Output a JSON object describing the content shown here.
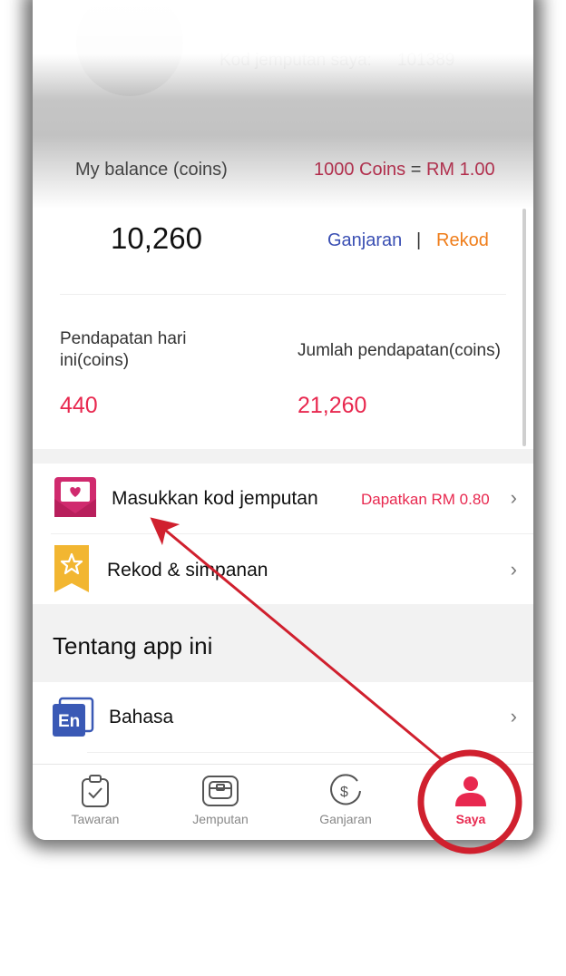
{
  "header": {
    "invite_label": "Kod jemputan saya:",
    "invite_code": "101389"
  },
  "balance": {
    "label": "My balance (coins)",
    "rate_coins": "1000 Coins",
    "rate_eq": " = ",
    "rate_rm": "RM 1.00",
    "value": "10,260",
    "ganjaran_link": "Ganjaran",
    "separator": "|",
    "rekod_link": "Rekod"
  },
  "earnings": {
    "today_label": "Pendapatan hari ini(coins)",
    "today_value": "440",
    "total_label": "Jumlah pendapatan(coins)",
    "total_value": "21,260"
  },
  "menu": [
    {
      "label": "Masukkan kod jemputan",
      "reward": "Dapatkan RM 0.80",
      "icon": "envelope-heart-icon"
    },
    {
      "label": "Rekod & simpanan",
      "reward": "",
      "icon": "star-badge-icon"
    }
  ],
  "about": {
    "title": "Tentang app ini",
    "language_label": "Bahasa",
    "language_icon_text": "En"
  },
  "nav": [
    {
      "label": "Tawaran",
      "icon": "clipboard-check-icon"
    },
    {
      "label": "Jemputan",
      "icon": "gift-box-icon"
    },
    {
      "label": "Ganjaran",
      "icon": "dollar-coin-icon"
    },
    {
      "label": "Saya",
      "icon": "person-icon",
      "active": true
    }
  ],
  "colors": {
    "accent_red": "#e8284f",
    "link_blue": "#3a4fb3",
    "link_orange": "#ef7d1a",
    "annotation_red": "#d0202e"
  }
}
